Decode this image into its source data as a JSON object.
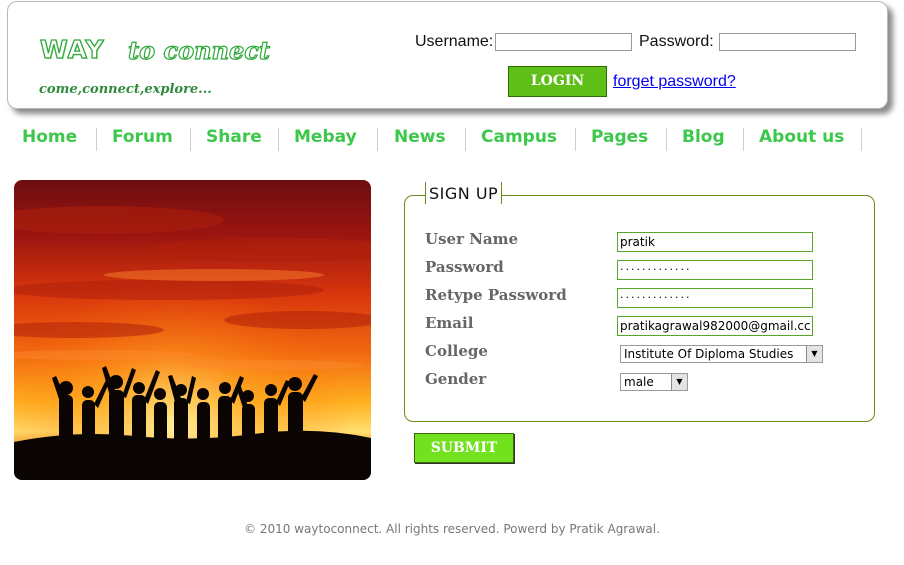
{
  "header": {
    "logo_way": "WAY",
    "logo_to": "to connect",
    "tagline": "come,connect,explore...",
    "username_label": "Username:",
    "password_label": "Password:",
    "login_label": "LOGIN",
    "forget_label": "forget password?"
  },
  "nav": {
    "items": [
      "Home",
      "Forum",
      "Share",
      "Mebay",
      "News",
      "Campus",
      "Pages",
      "Blog",
      "About us"
    ]
  },
  "signup": {
    "legend": "SIGN UP",
    "fields": {
      "user_name": {
        "label": "User Name",
        "value": "pratik"
      },
      "password": {
        "label": "Password",
        "value": "·············"
      },
      "retype": {
        "label": "Retype Password",
        "value": "·············"
      },
      "email": {
        "label": "Email",
        "value": "pratikagrawal982000@gmail.cc"
      },
      "college": {
        "label": "College",
        "value": "Institute Of Diploma Studies"
      },
      "gender": {
        "label": "Gender",
        "value": "male"
      }
    },
    "submit_label": "SUBMIT"
  },
  "footer": {
    "text": "© 2010 waytoconnect. All rights reserved. Powerd by Pratik Agrawal."
  },
  "colors": {
    "nav_green": "#3cc84a",
    "login_green": "#5fbf18",
    "submit_green": "#72e21e",
    "fieldset_border": "#6a8c1a"
  }
}
